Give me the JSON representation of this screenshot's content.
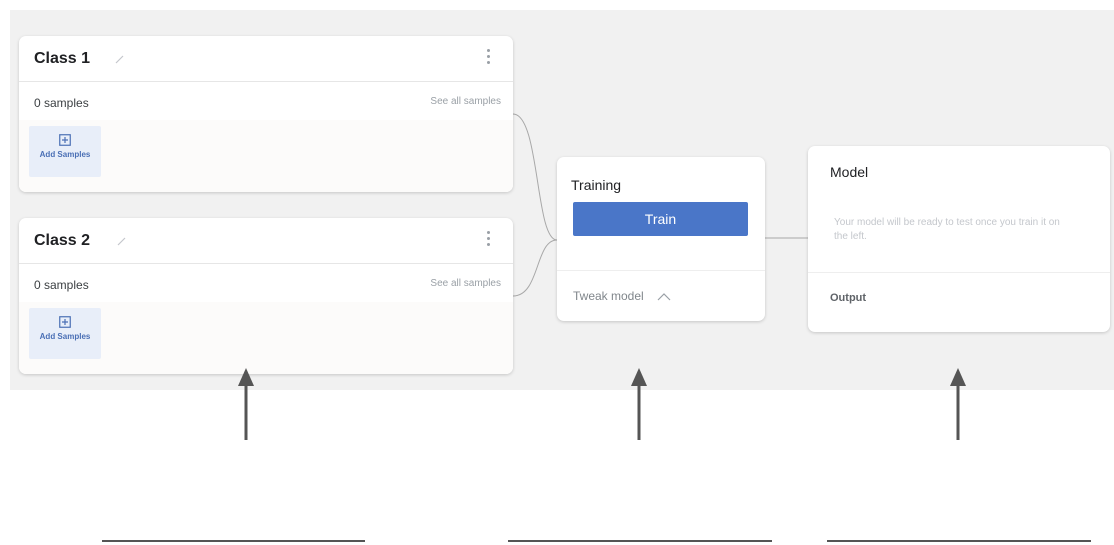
{
  "classes": [
    {
      "title": "Class 1",
      "samples": "0 samples",
      "see_all": "See all samples",
      "add_label": "Add Samples"
    },
    {
      "title": "Class 2",
      "samples": "0 samples",
      "see_all": "See all samples",
      "add_label": "Add Samples"
    }
  ],
  "training": {
    "title": "Training",
    "train_label": "Train",
    "tweak_label": "Tweak model"
  },
  "model": {
    "title": "Model",
    "message": "Your model will be ready to test once you train it on the left.",
    "output_label": "Output"
  },
  "icons": [
    "pencil-icon",
    "kebab-menu-icon",
    "add-box-icon",
    "chevron-up-icon",
    "up-arrow-icon"
  ],
  "colors": {
    "accent": "#4a76c8",
    "canvas": "#f1f1f1",
    "add_bg": "#e8eef9"
  }
}
